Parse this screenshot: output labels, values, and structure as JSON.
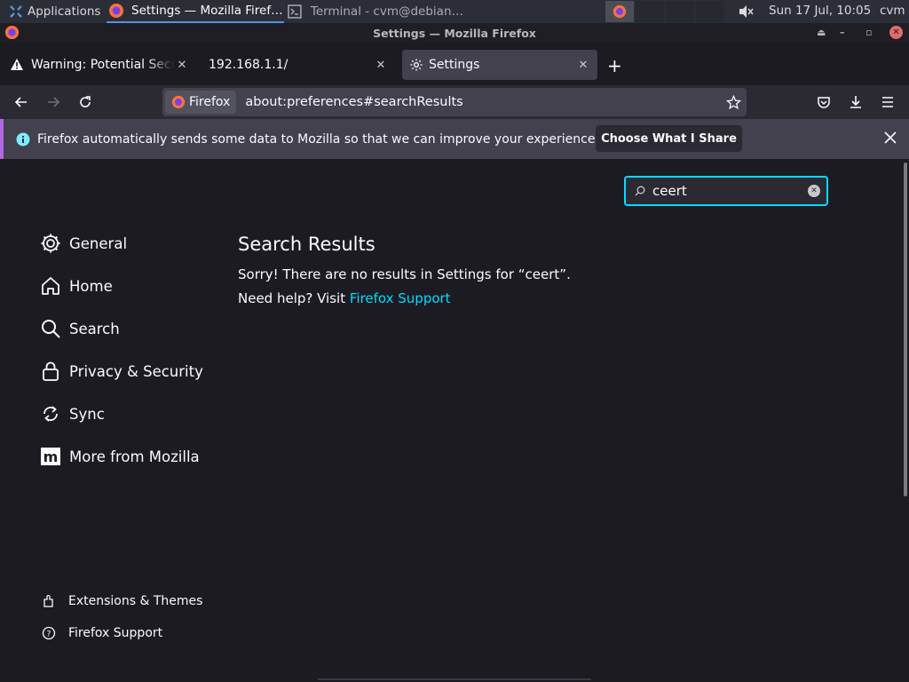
{
  "taskbar": {
    "applications_label": "Applications",
    "apps": [
      {
        "title": "Settings — Mozilla Firef…"
      },
      {
        "title": "Terminal - cvm@debian…"
      }
    ],
    "clock": "Sun 17 Jul, 10:05",
    "user": "cvm"
  },
  "window": {
    "title": "Settings — Mozilla Firefox"
  },
  "tabs": [
    {
      "title": "Warning: Potential Security Risk Ahead"
    },
    {
      "title": "192.168.1.1/"
    },
    {
      "title": "Settings"
    }
  ],
  "urlbar": {
    "identity_label": "Firefox",
    "url": "about:preferences#searchResults"
  },
  "notification": {
    "message": "Firefox automatically sends some data to Mozilla so that we can improve your experience.",
    "button_label": "Choose What I Share"
  },
  "search": {
    "value": "ceert"
  },
  "sidebar": {
    "categories": [
      {
        "label": "General",
        "icon": "gear-icon"
      },
      {
        "label": "Home",
        "icon": "home-icon"
      },
      {
        "label": "Search",
        "icon": "search-icon"
      },
      {
        "label": "Privacy & Security",
        "icon": "lock-icon"
      },
      {
        "label": "Sync",
        "icon": "sync-icon"
      },
      {
        "label": "More from Mozilla",
        "icon": "mozilla-icon"
      }
    ],
    "footer": [
      {
        "label": "Extensions & Themes",
        "icon": "puzzle-icon"
      },
      {
        "label": "Firefox Support",
        "icon": "help-icon"
      }
    ]
  },
  "results": {
    "title": "Search Results",
    "no_results": "Sorry! There are no results in Settings for “ceert”.",
    "help_prefix": "Need help? Visit ",
    "help_link": "Firefox Support"
  },
  "colors": {
    "accent": "#00ddff",
    "background": "#1c1b22",
    "notification_border": "#b267e3"
  }
}
